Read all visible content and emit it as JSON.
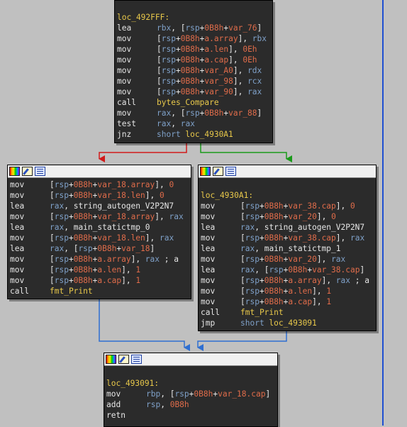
{
  "colors": {
    "background": "#c0c0c0",
    "node_bg": "#2b2b2b",
    "edge_false": "#d11a1a",
    "edge_true": "#1a9a1a",
    "edge_jump": "#2f6fd1"
  },
  "header_icons": [
    "color-palette-icon",
    "rename-pencil-icon",
    "graph-overview-icon"
  ],
  "blocks": {
    "top": {
      "label": "loc_492FFF:",
      "lines": [
        {
          "m": "lea",
          "p": [
            [
              "kw",
              "rbx"
            ],
            [
              "br",
              ", ["
            ],
            [
              "kw",
              "rsp"
            ],
            [
              "br",
              "+"
            ],
            [
              "num",
              "0B8h"
            ],
            [
              "br",
              "+"
            ],
            [
              "var",
              "var_76"
            ],
            [
              "br",
              "]"
            ]
          ]
        },
        {
          "m": "mov",
          "p": [
            [
              "br",
              "["
            ],
            [
              "kw",
              "rsp"
            ],
            [
              "br",
              "+"
            ],
            [
              "num",
              "0B8h"
            ],
            [
              "br",
              "+"
            ],
            [
              "var",
              "a.array"
            ],
            [
              "br",
              "], "
            ],
            [
              "kw",
              "rbx"
            ]
          ]
        },
        {
          "m": "mov",
          "p": [
            [
              "br",
              "["
            ],
            [
              "kw",
              "rsp"
            ],
            [
              "br",
              "+"
            ],
            [
              "num",
              "0B8h"
            ],
            [
              "br",
              "+"
            ],
            [
              "var",
              "a.len"
            ],
            [
              "br",
              "], "
            ],
            [
              "num",
              "0Eh"
            ]
          ]
        },
        {
          "m": "mov",
          "p": [
            [
              "br",
              "["
            ],
            [
              "kw",
              "rsp"
            ],
            [
              "br",
              "+"
            ],
            [
              "num",
              "0B8h"
            ],
            [
              "br",
              "+"
            ],
            [
              "var",
              "a.cap"
            ],
            [
              "br",
              "], "
            ],
            [
              "num",
              "0Eh"
            ]
          ]
        },
        {
          "m": "mov",
          "p": [
            [
              "br",
              "["
            ],
            [
              "kw",
              "rsp"
            ],
            [
              "br",
              "+"
            ],
            [
              "num",
              "0B8h"
            ],
            [
              "br",
              "+"
            ],
            [
              "var",
              "var_A0"
            ],
            [
              "br",
              "], "
            ],
            [
              "kw",
              "rdx"
            ]
          ]
        },
        {
          "m": "mov",
          "p": [
            [
              "br",
              "["
            ],
            [
              "kw",
              "rsp"
            ],
            [
              "br",
              "+"
            ],
            [
              "num",
              "0B8h"
            ],
            [
              "br",
              "+"
            ],
            [
              "var",
              "var_98"
            ],
            [
              "br",
              "], "
            ],
            [
              "kw",
              "rcx"
            ]
          ]
        },
        {
          "m": "mov",
          "p": [
            [
              "br",
              "["
            ],
            [
              "kw",
              "rsp"
            ],
            [
              "br",
              "+"
            ],
            [
              "num",
              "0B8h"
            ],
            [
              "br",
              "+"
            ],
            [
              "var",
              "var_90"
            ],
            [
              "br",
              "], "
            ],
            [
              "kw",
              "rax"
            ]
          ]
        },
        {
          "m": "call",
          "p": [
            [
              "fn",
              "bytes_Compare"
            ]
          ]
        },
        {
          "m": "mov",
          "p": [
            [
              "kw",
              "rax"
            ],
            [
              "br",
              ", ["
            ],
            [
              "kw",
              "rsp"
            ],
            [
              "br",
              "+"
            ],
            [
              "num",
              "0B8h"
            ],
            [
              "br",
              "+"
            ],
            [
              "var",
              "var_88"
            ],
            [
              "br",
              "]"
            ]
          ]
        },
        {
          "m": "test",
          "p": [
            [
              "kw",
              "rax"
            ],
            [
              "br",
              ", "
            ],
            [
              "kw",
              "rax"
            ]
          ]
        },
        {
          "m": "jnz",
          "p": [
            [
              "kw",
              "short "
            ],
            [
              "fn",
              "loc_4930A1"
            ]
          ]
        }
      ]
    },
    "left": {
      "lines": [
        {
          "m": "mov",
          "p": [
            [
              "br",
              "["
            ],
            [
              "kw",
              "rsp"
            ],
            [
              "br",
              "+"
            ],
            [
              "num",
              "0B8h"
            ],
            [
              "br",
              "+"
            ],
            [
              "var",
              "var_18.array"
            ],
            [
              "br",
              "], "
            ],
            [
              "num",
              "0"
            ]
          ]
        },
        {
          "m": "mov",
          "p": [
            [
              "br",
              "["
            ],
            [
              "kw",
              "rsp"
            ],
            [
              "br",
              "+"
            ],
            [
              "num",
              "0B8h"
            ],
            [
              "br",
              "+"
            ],
            [
              "var",
              "var_18.len"
            ],
            [
              "br",
              "], "
            ],
            [
              "num",
              "0"
            ]
          ]
        },
        {
          "m": "lea",
          "p": [
            [
              "kw",
              "rax"
            ],
            [
              "br",
              ", "
            ],
            [
              "br",
              "string_autogen_V2P2N7"
            ]
          ]
        },
        {
          "m": "mov",
          "p": [
            [
              "br",
              "["
            ],
            [
              "kw",
              "rsp"
            ],
            [
              "br",
              "+"
            ],
            [
              "num",
              "0B8h"
            ],
            [
              "br",
              "+"
            ],
            [
              "var",
              "var_18.array"
            ],
            [
              "br",
              "], "
            ],
            [
              "kw",
              "rax"
            ]
          ]
        },
        {
          "m": "lea",
          "p": [
            [
              "kw",
              "rax"
            ],
            [
              "br",
              ", "
            ],
            [
              "br",
              "main_statictmp_0"
            ]
          ]
        },
        {
          "m": "mov",
          "p": [
            [
              "br",
              "["
            ],
            [
              "kw",
              "rsp"
            ],
            [
              "br",
              "+"
            ],
            [
              "num",
              "0B8h"
            ],
            [
              "br",
              "+"
            ],
            [
              "var",
              "var_18.len"
            ],
            [
              "br",
              "], "
            ],
            [
              "kw",
              "rax"
            ]
          ]
        },
        {
          "m": "lea",
          "p": [
            [
              "kw",
              "rax"
            ],
            [
              "br",
              ", ["
            ],
            [
              "kw",
              "rsp"
            ],
            [
              "br",
              "+"
            ],
            [
              "num",
              "0B8h"
            ],
            [
              "br",
              "+"
            ],
            [
              "var",
              "var_18"
            ],
            [
              "br",
              "]"
            ]
          ]
        },
        {
          "m": "mov",
          "p": [
            [
              "br",
              "["
            ],
            [
              "kw",
              "rsp"
            ],
            [
              "br",
              "+"
            ],
            [
              "num",
              "0B8h"
            ],
            [
              "br",
              "+"
            ],
            [
              "var",
              "a.array"
            ],
            [
              "br",
              "], "
            ],
            [
              "kw",
              "rax"
            ],
            [
              "br",
              " ; a"
            ]
          ]
        },
        {
          "m": "mov",
          "p": [
            [
              "br",
              "["
            ],
            [
              "kw",
              "rsp"
            ],
            [
              "br",
              "+"
            ],
            [
              "num",
              "0B8h"
            ],
            [
              "br",
              "+"
            ],
            [
              "var",
              "a.len"
            ],
            [
              "br",
              "], "
            ],
            [
              "num",
              "1"
            ]
          ]
        },
        {
          "m": "mov",
          "p": [
            [
              "br",
              "["
            ],
            [
              "kw",
              "rsp"
            ],
            [
              "br",
              "+"
            ],
            [
              "num",
              "0B8h"
            ],
            [
              "br",
              "+"
            ],
            [
              "var",
              "a.cap"
            ],
            [
              "br",
              "], "
            ],
            [
              "num",
              "1"
            ]
          ]
        },
        {
          "m": "call",
          "p": [
            [
              "fn",
              "fmt_Print"
            ]
          ]
        }
      ]
    },
    "right": {
      "label": "loc_4930A1:",
      "lines": [
        {
          "m": "mov",
          "p": [
            [
              "br",
              "["
            ],
            [
              "kw",
              "rsp"
            ],
            [
              "br",
              "+"
            ],
            [
              "num",
              "0B8h"
            ],
            [
              "br",
              "+"
            ],
            [
              "var",
              "var_38.cap"
            ],
            [
              "br",
              "], "
            ],
            [
              "num",
              "0"
            ]
          ]
        },
        {
          "m": "mov",
          "p": [
            [
              "br",
              "["
            ],
            [
              "kw",
              "rsp"
            ],
            [
              "br",
              "+"
            ],
            [
              "num",
              "0B8h"
            ],
            [
              "br",
              "+"
            ],
            [
              "var",
              "var_20"
            ],
            [
              "br",
              "], "
            ],
            [
              "num",
              "0"
            ]
          ]
        },
        {
          "m": "lea",
          "p": [
            [
              "kw",
              "rax"
            ],
            [
              "br",
              ", "
            ],
            [
              "br",
              "string_autogen_V2P2N7"
            ]
          ]
        },
        {
          "m": "mov",
          "p": [
            [
              "br",
              "["
            ],
            [
              "kw",
              "rsp"
            ],
            [
              "br",
              "+"
            ],
            [
              "num",
              "0B8h"
            ],
            [
              "br",
              "+"
            ],
            [
              "var",
              "var_38.cap"
            ],
            [
              "br",
              "], "
            ],
            [
              "kw",
              "rax"
            ]
          ]
        },
        {
          "m": "lea",
          "p": [
            [
              "kw",
              "rax"
            ],
            [
              "br",
              ", "
            ],
            [
              "br",
              "main_statictmp_1"
            ]
          ]
        },
        {
          "m": "mov",
          "p": [
            [
              "br",
              "["
            ],
            [
              "kw",
              "rsp"
            ],
            [
              "br",
              "+"
            ],
            [
              "num",
              "0B8h"
            ],
            [
              "br",
              "+"
            ],
            [
              "var",
              "var_20"
            ],
            [
              "br",
              "], "
            ],
            [
              "kw",
              "rax"
            ]
          ]
        },
        {
          "m": "lea",
          "p": [
            [
              "kw",
              "rax"
            ],
            [
              "br",
              ", ["
            ],
            [
              "kw",
              "rsp"
            ],
            [
              "br",
              "+"
            ],
            [
              "num",
              "0B8h"
            ],
            [
              "br",
              "+"
            ],
            [
              "var",
              "var_38.cap"
            ],
            [
              "br",
              "]"
            ]
          ]
        },
        {
          "m": "mov",
          "p": [
            [
              "br",
              "["
            ],
            [
              "kw",
              "rsp"
            ],
            [
              "br",
              "+"
            ],
            [
              "num",
              "0B8h"
            ],
            [
              "br",
              "+"
            ],
            [
              "var",
              "a.array"
            ],
            [
              "br",
              "], "
            ],
            [
              "kw",
              "rax"
            ],
            [
              "br",
              " ; a"
            ]
          ]
        },
        {
          "m": "mov",
          "p": [
            [
              "br",
              "["
            ],
            [
              "kw",
              "rsp"
            ],
            [
              "br",
              "+"
            ],
            [
              "num",
              "0B8h"
            ],
            [
              "br",
              "+"
            ],
            [
              "var",
              "a.len"
            ],
            [
              "br",
              "], "
            ],
            [
              "num",
              "1"
            ]
          ]
        },
        {
          "m": "mov",
          "p": [
            [
              "br",
              "["
            ],
            [
              "kw",
              "rsp"
            ],
            [
              "br",
              "+"
            ],
            [
              "num",
              "0B8h"
            ],
            [
              "br",
              "+"
            ],
            [
              "var",
              "a.cap"
            ],
            [
              "br",
              "], "
            ],
            [
              "num",
              "1"
            ]
          ]
        },
        {
          "m": "call",
          "p": [
            [
              "fn",
              "fmt_Print"
            ]
          ]
        },
        {
          "m": "jmp",
          "p": [
            [
              "kw",
              "short "
            ],
            [
              "fn",
              "loc_493091"
            ]
          ]
        }
      ]
    },
    "bottom": {
      "label": "loc_493091:",
      "lines": [
        {
          "m": "mov",
          "p": [
            [
              "kw",
              "rbp"
            ],
            [
              "br",
              ", ["
            ],
            [
              "kw",
              "rsp"
            ],
            [
              "br",
              "+"
            ],
            [
              "num",
              "0B8h"
            ],
            [
              "br",
              "+"
            ],
            [
              "var",
              "var_18.cap"
            ],
            [
              "br",
              "]"
            ]
          ]
        },
        {
          "m": "add",
          "p": [
            [
              "kw",
              "rsp"
            ],
            [
              "br",
              ", "
            ],
            [
              "num",
              "0B8h"
            ]
          ]
        },
        {
          "m": "retn",
          "p": []
        }
      ]
    }
  }
}
